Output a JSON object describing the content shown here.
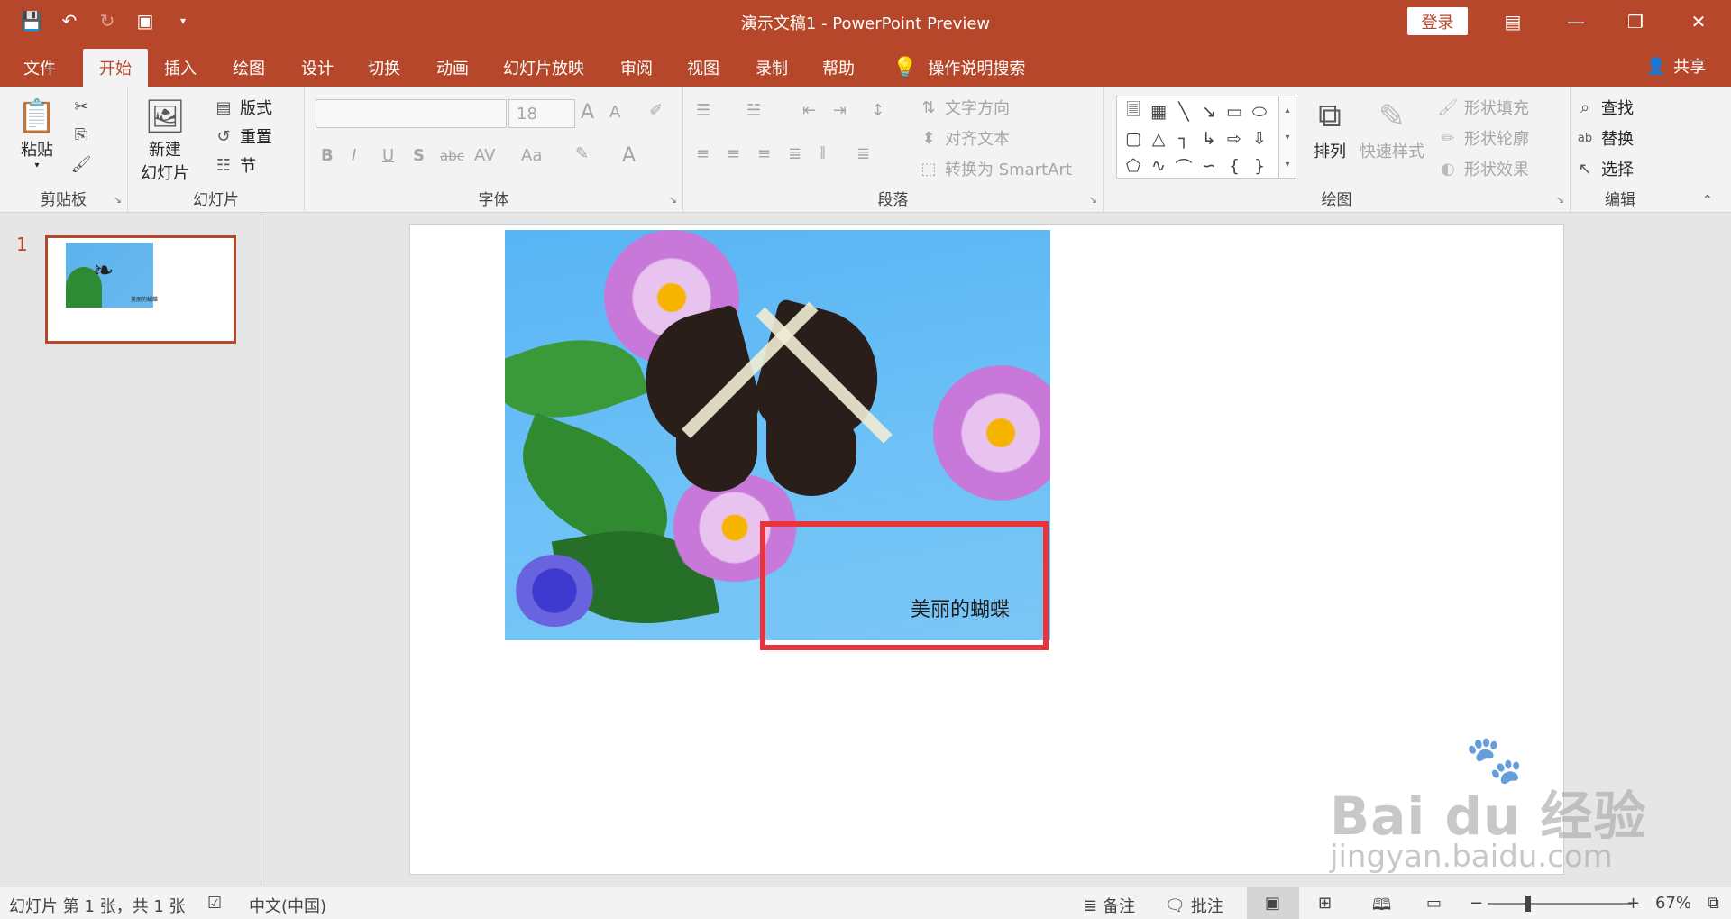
{
  "titlebar": {
    "title": "演示文稿1  -  PowerPoint Preview",
    "login": "登录"
  },
  "tabs": [
    {
      "label": "文件"
    },
    {
      "label": "开始"
    },
    {
      "label": "插入"
    },
    {
      "label": "绘图"
    },
    {
      "label": "设计"
    },
    {
      "label": "切换"
    },
    {
      "label": "动画"
    },
    {
      "label": "幻灯片放映"
    },
    {
      "label": "审阅"
    },
    {
      "label": "视图"
    },
    {
      "label": "录制"
    },
    {
      "label": "帮助"
    },
    {
      "label": "操作说明搜索"
    }
  ],
  "share": "共享",
  "ribbon": {
    "clipboard": {
      "label": "剪贴板",
      "paste": "粘贴"
    },
    "slides": {
      "label": "幻灯片",
      "new_slide_1": "新建",
      "new_slide_2": "幻灯片",
      "layout": "版式",
      "reset": "重置",
      "section": "节"
    },
    "font": {
      "label": "字体",
      "size": "18",
      "bold": "B",
      "italic": "I",
      "underline": "U",
      "shadow": "S",
      "strike": "abc",
      "spacing": "AV",
      "case": "Aa",
      "color": "A",
      "grow": "A",
      "shrink": "A"
    },
    "paragraph": {
      "label": "段落",
      "text_direction": "文字方向",
      "align_text": "对齐文本",
      "smartart": "转换为 SmartArt"
    },
    "drawing": {
      "label": "绘图",
      "arrange": "排列",
      "quick_styles": "快速样式",
      "fill": "形状填充",
      "outline": "形状轮廓",
      "effects": "形状效果"
    },
    "editing": {
      "label": "编辑",
      "find": "查找",
      "replace": "替换",
      "select": "选择"
    }
  },
  "thumbnails": [
    {
      "number": "1",
      "caption": "美丽的蝴蝶"
    }
  ],
  "slide": {
    "caption": "美丽的蝴蝶"
  },
  "watermark": {
    "brand": "Bai du 经验",
    "url": "jingyan.baidu.com"
  },
  "status": {
    "slide_info": "幻灯片 第 1 张，共 1 张",
    "language": "中文(中国)",
    "notes": "备注",
    "comments": "批注",
    "zoom": "67%"
  }
}
